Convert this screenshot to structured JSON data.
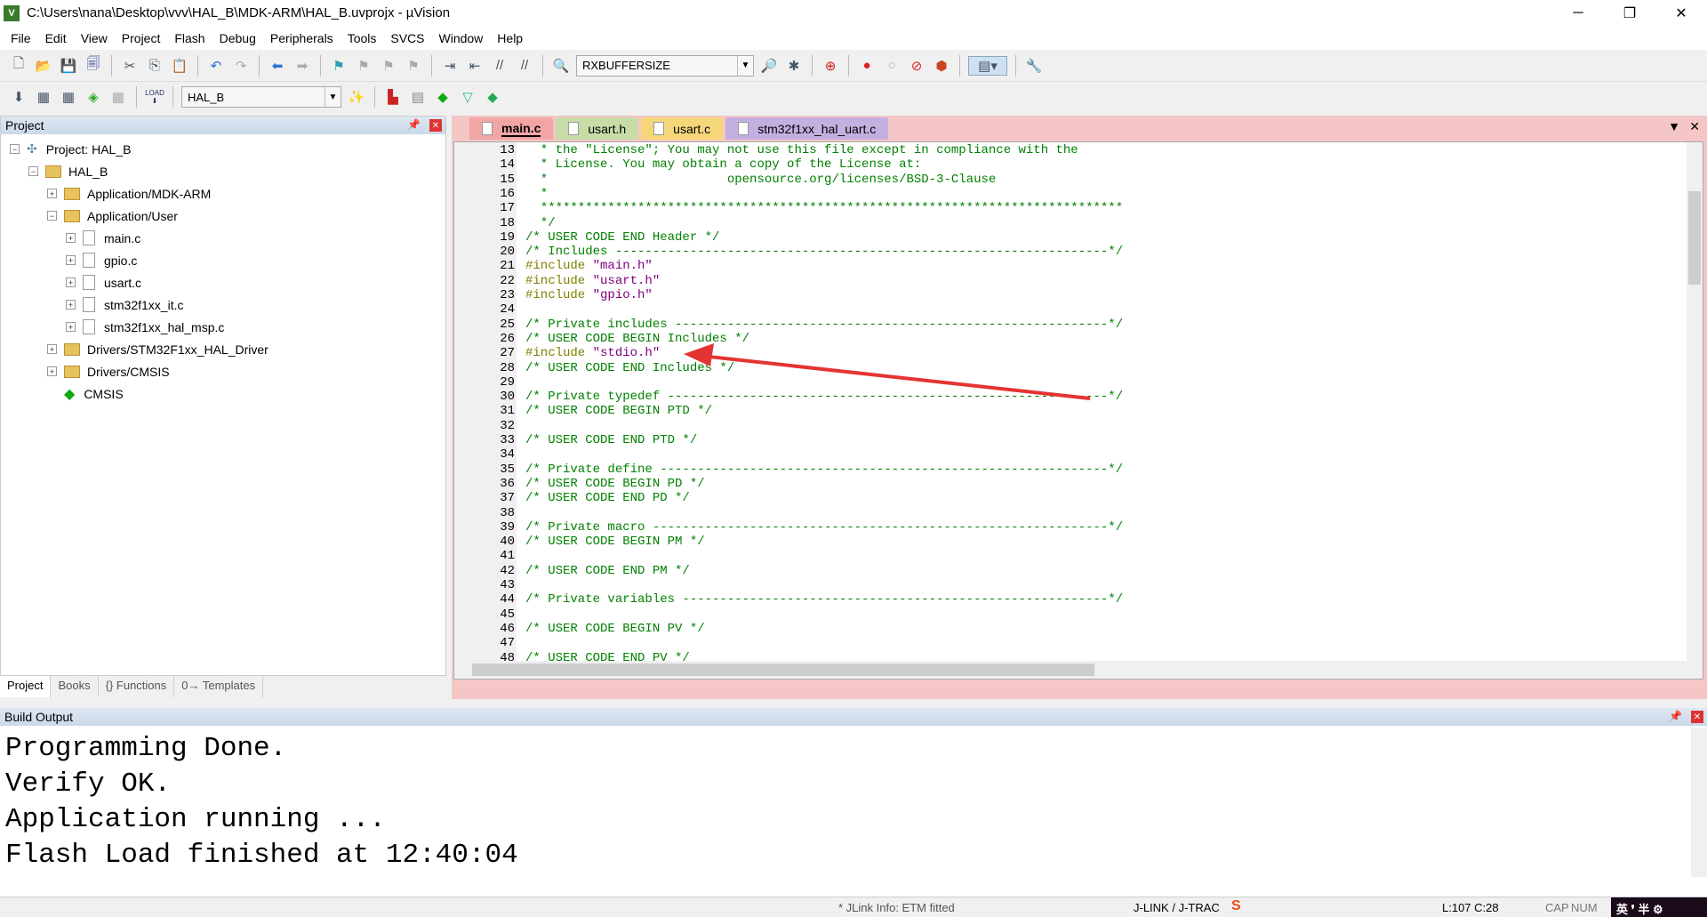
{
  "window": {
    "title": "C:\\Users\\nana\\Desktop\\vvv\\HAL_B\\MDK-ARM\\HAL_B.uvprojx - µVision",
    "controls": [
      "─",
      "❐",
      "✕"
    ]
  },
  "menu": [
    "File",
    "Edit",
    "View",
    "Project",
    "Flash",
    "Debug",
    "Peripherals",
    "Tools",
    "SVCS",
    "Window",
    "Help"
  ],
  "toolbar": {
    "find_combo": "RXBUFFERSIZE",
    "target_combo": "HAL_B",
    "load_label": "LOAD"
  },
  "project_panel": {
    "title": "Project",
    "tree": [
      {
        "label": "Project: HAL_B",
        "depth": 0,
        "exp": "−",
        "kind": "project"
      },
      {
        "label": "HAL_B",
        "depth": 1,
        "exp": "−",
        "kind": "target"
      },
      {
        "label": "Application/MDK-ARM",
        "depth": 2,
        "exp": "+",
        "kind": "folder"
      },
      {
        "label": "Application/User",
        "depth": 2,
        "exp": "−",
        "kind": "folder"
      },
      {
        "label": "main.c",
        "depth": 3,
        "exp": "+",
        "kind": "file"
      },
      {
        "label": "gpio.c",
        "depth": 3,
        "exp": "+",
        "kind": "file"
      },
      {
        "label": "usart.c",
        "depth": 3,
        "exp": "+",
        "kind": "file"
      },
      {
        "label": "stm32f1xx_it.c",
        "depth": 3,
        "exp": "+",
        "kind": "file"
      },
      {
        "label": "stm32f1xx_hal_msp.c",
        "depth": 3,
        "exp": "+",
        "kind": "file"
      },
      {
        "label": "Drivers/STM32F1xx_HAL_Driver",
        "depth": 2,
        "exp": "+",
        "kind": "folder"
      },
      {
        "label": "Drivers/CMSIS",
        "depth": 2,
        "exp": "+",
        "kind": "folder"
      },
      {
        "label": "CMSIS",
        "depth": 2,
        "exp": "",
        "kind": "cmsis"
      }
    ],
    "tabs": [
      "Project",
      "Books",
      "{} Functions",
      "0→ Templates"
    ]
  },
  "editor": {
    "tabs": [
      {
        "label": "main.c",
        "color": "#f2a5a5",
        "active": true
      },
      {
        "label": "usart.h",
        "color": "#c8dca8"
      },
      {
        "label": "usart.c",
        "color": "#f5d77a"
      },
      {
        "label": "stm32f1xx_hal_uart.c",
        "color": "#c4b0e0"
      }
    ],
    "lines": [
      {
        "n": "13",
        "parts": [
          [
            "cm",
            "  * the \"License\"; You may not use this file except in compliance with the"
          ]
        ]
      },
      {
        "n": "14",
        "parts": [
          [
            "cm",
            "  * License. You may obtain a copy of the License at:"
          ]
        ]
      },
      {
        "n": "15",
        "parts": [
          [
            "cm",
            "  *                        opensource.org/licenses/BSD-3-Clause"
          ]
        ]
      },
      {
        "n": "16",
        "parts": [
          [
            "cm",
            "  *"
          ]
        ]
      },
      {
        "n": "17",
        "parts": [
          [
            "cm",
            "  ******************************************************************************"
          ]
        ]
      },
      {
        "n": "18",
        "parts": [
          [
            "cm",
            "  */"
          ]
        ]
      },
      {
        "n": "19",
        "parts": [
          [
            "cm",
            "/* USER CODE END Header */"
          ]
        ]
      },
      {
        "n": "20",
        "parts": [
          [
            "cm",
            "/* Includes ------------------------------------------------------------------*/"
          ]
        ]
      },
      {
        "n": "21",
        "parts": [
          [
            "pp",
            "#include "
          ],
          [
            "st",
            "\"main.h\""
          ]
        ]
      },
      {
        "n": "22",
        "parts": [
          [
            "pp",
            "#include "
          ],
          [
            "st",
            "\"usart.h\""
          ]
        ]
      },
      {
        "n": "23",
        "parts": [
          [
            "pp",
            "#include "
          ],
          [
            "st",
            "\"gpio.h\""
          ]
        ]
      },
      {
        "n": "24",
        "parts": []
      },
      {
        "n": "25",
        "parts": [
          [
            "cm",
            "/* Private includes ----------------------------------------------------------*/"
          ]
        ]
      },
      {
        "n": "26",
        "parts": [
          [
            "cm",
            "/* USER CODE BEGIN Includes */"
          ]
        ]
      },
      {
        "n": "27",
        "parts": [
          [
            "pp",
            "#include "
          ],
          [
            "st",
            "\"stdio.h\""
          ]
        ]
      },
      {
        "n": "28",
        "parts": [
          [
            "cm",
            "/* USER CODE END Includes */"
          ]
        ]
      },
      {
        "n": "29",
        "parts": []
      },
      {
        "n": "30",
        "parts": [
          [
            "cm",
            "/* Private typedef -----------------------------------------------------------*/"
          ]
        ]
      },
      {
        "n": "31",
        "parts": [
          [
            "cm",
            "/* USER CODE BEGIN PTD */"
          ]
        ]
      },
      {
        "n": "32",
        "parts": []
      },
      {
        "n": "33",
        "parts": [
          [
            "cm",
            "/* USER CODE END PTD */"
          ]
        ]
      },
      {
        "n": "34",
        "parts": []
      },
      {
        "n": "35",
        "parts": [
          [
            "cm",
            "/* Private define ------------------------------------------------------------*/"
          ]
        ]
      },
      {
        "n": "36",
        "parts": [
          [
            "cm",
            "/* USER CODE BEGIN PD */"
          ]
        ]
      },
      {
        "n": "37",
        "parts": [
          [
            "cm",
            "/* USER CODE END PD */"
          ]
        ]
      },
      {
        "n": "38",
        "parts": []
      },
      {
        "n": "39",
        "parts": [
          [
            "cm",
            "/* Private macro -------------------------------------------------------------*/"
          ]
        ]
      },
      {
        "n": "40",
        "parts": [
          [
            "cm",
            "/* USER CODE BEGIN PM */"
          ]
        ]
      },
      {
        "n": "41",
        "parts": []
      },
      {
        "n": "42",
        "parts": [
          [
            "cm",
            "/* USER CODE END PM */"
          ]
        ]
      },
      {
        "n": "43",
        "parts": []
      },
      {
        "n": "44",
        "parts": [
          [
            "cm",
            "/* Private variables ---------------------------------------------------------*/"
          ]
        ]
      },
      {
        "n": "45",
        "parts": []
      },
      {
        "n": "46",
        "parts": [
          [
            "cm",
            "/* USER CODE BEGIN PV */"
          ]
        ]
      },
      {
        "n": "47",
        "parts": []
      },
      {
        "n": "48",
        "parts": [
          [
            "cm",
            "/* USER CODE END PV */"
          ]
        ]
      },
      {
        "n": "49",
        "parts": []
      }
    ],
    "annotation_arrow_color": "#e53333"
  },
  "build_output": {
    "title": "Build Output",
    "text": "Programming Done.\nVerify OK.\nApplication running ...\nFlash Load finished at 12:40:04"
  },
  "status": {
    "info": "* JLink Info: ETM fitted",
    "debugger": "J-LINK / J-TRAC",
    "position": "L:107 C:28",
    "cap": "CAP",
    "num": "NUM",
    "ime": "英 ❜ 半 ⚙"
  }
}
